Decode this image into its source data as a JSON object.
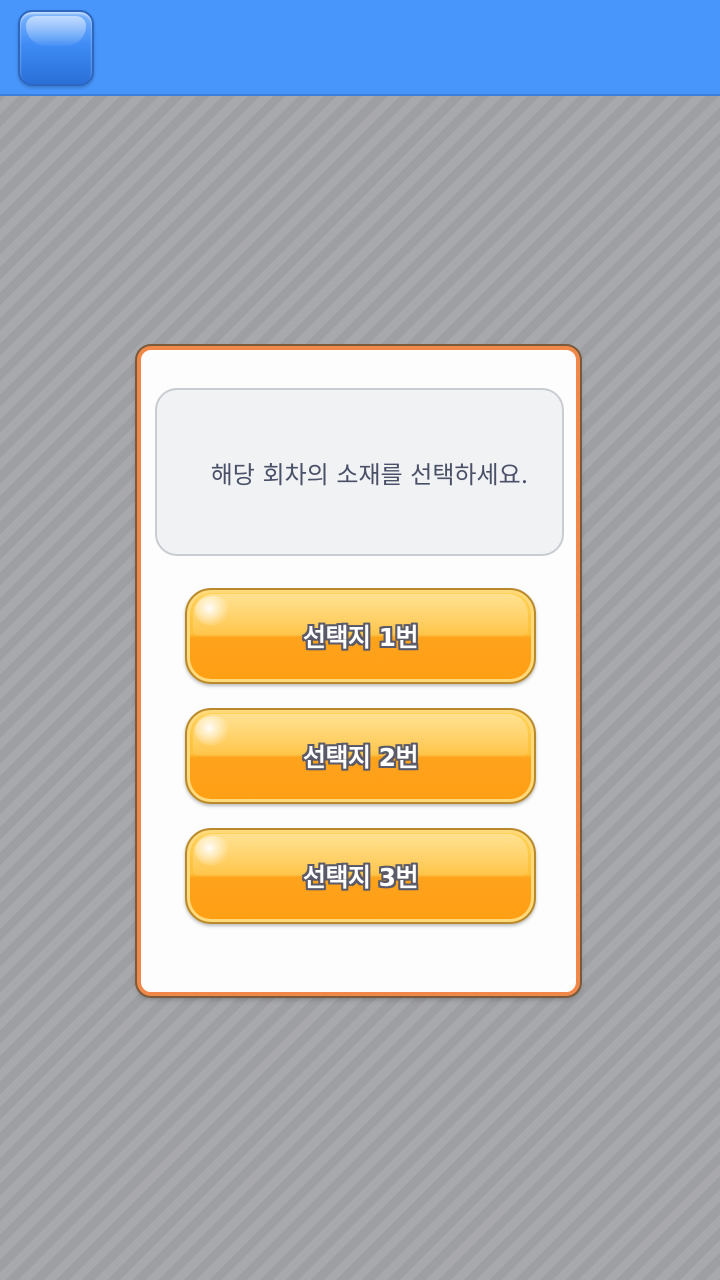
{
  "header": {
    "app_button_icon": "rounded-square-icon",
    "background_color": "#4896fc"
  },
  "dialog": {
    "question": "해당 회차의 소재를 선택하세요.",
    "choices": [
      {
        "label": "선택지 1번"
      },
      {
        "label": "선택지 2번"
      },
      {
        "label": "선택지 3번"
      }
    ],
    "border_color": "#f0884a",
    "choice_color": "#ffa21c"
  }
}
